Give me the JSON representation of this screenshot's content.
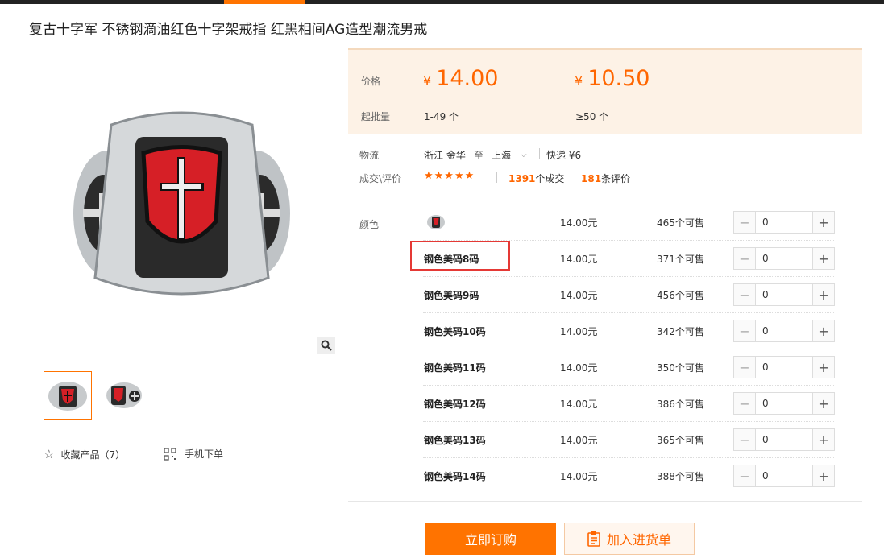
{
  "title": "复古十字军 不锈钢滴油红色十字架戒指 红黑相间AG造型潮流男戒",
  "gallery": {
    "favorite_label": "收藏产品（7）",
    "mobile_label": "手机下单"
  },
  "pricing": {
    "price_label": "价格",
    "moq_label": "起批量",
    "currency": "¥",
    "tiers": [
      {
        "price": "14.00",
        "qty": "1-49 个"
      },
      {
        "price": "10.50",
        "qty": "≥50 个"
      }
    ]
  },
  "logistics": {
    "label": "物流",
    "origin": "浙江 金华",
    "to": "至",
    "destination": "上海",
    "express": "快递 ¥6"
  },
  "reviews": {
    "label": "成交\\评价",
    "stars": "★★★★★",
    "deals_count": "1391",
    "deals_suffix": "个成交",
    "review_count": "181",
    "review_suffix": "条评价"
  },
  "color_label": "颜色",
  "variants": [
    {
      "name": "",
      "price": "14.00元",
      "stock": "465个可售",
      "qty": "0"
    },
    {
      "name": "钢色美码8码",
      "price": "14.00元",
      "stock": "371个可售",
      "qty": "0"
    },
    {
      "name": "钢色美码9码",
      "price": "14.00元",
      "stock": "456个可售",
      "qty": "0"
    },
    {
      "name": "钢色美码10码",
      "price": "14.00元",
      "stock": "342个可售",
      "qty": "0"
    },
    {
      "name": "钢色美码11码",
      "price": "14.00元",
      "stock": "350个可售",
      "qty": "0"
    },
    {
      "name": "钢色美码12码",
      "price": "14.00元",
      "stock": "386个可售",
      "qty": "0"
    },
    {
      "name": "钢色美码13码",
      "price": "14.00元",
      "stock": "365个可售",
      "qty": "0"
    },
    {
      "name": "钢色美码14码",
      "price": "14.00元",
      "stock": "388个可售",
      "qty": "0"
    }
  ],
  "actions": {
    "buy_now": "立即订购",
    "add_to_list": "加入进货单"
  },
  "colors": {
    "accent": "#ff7300",
    "price": "#ff6600",
    "highlight": "#e53935"
  }
}
